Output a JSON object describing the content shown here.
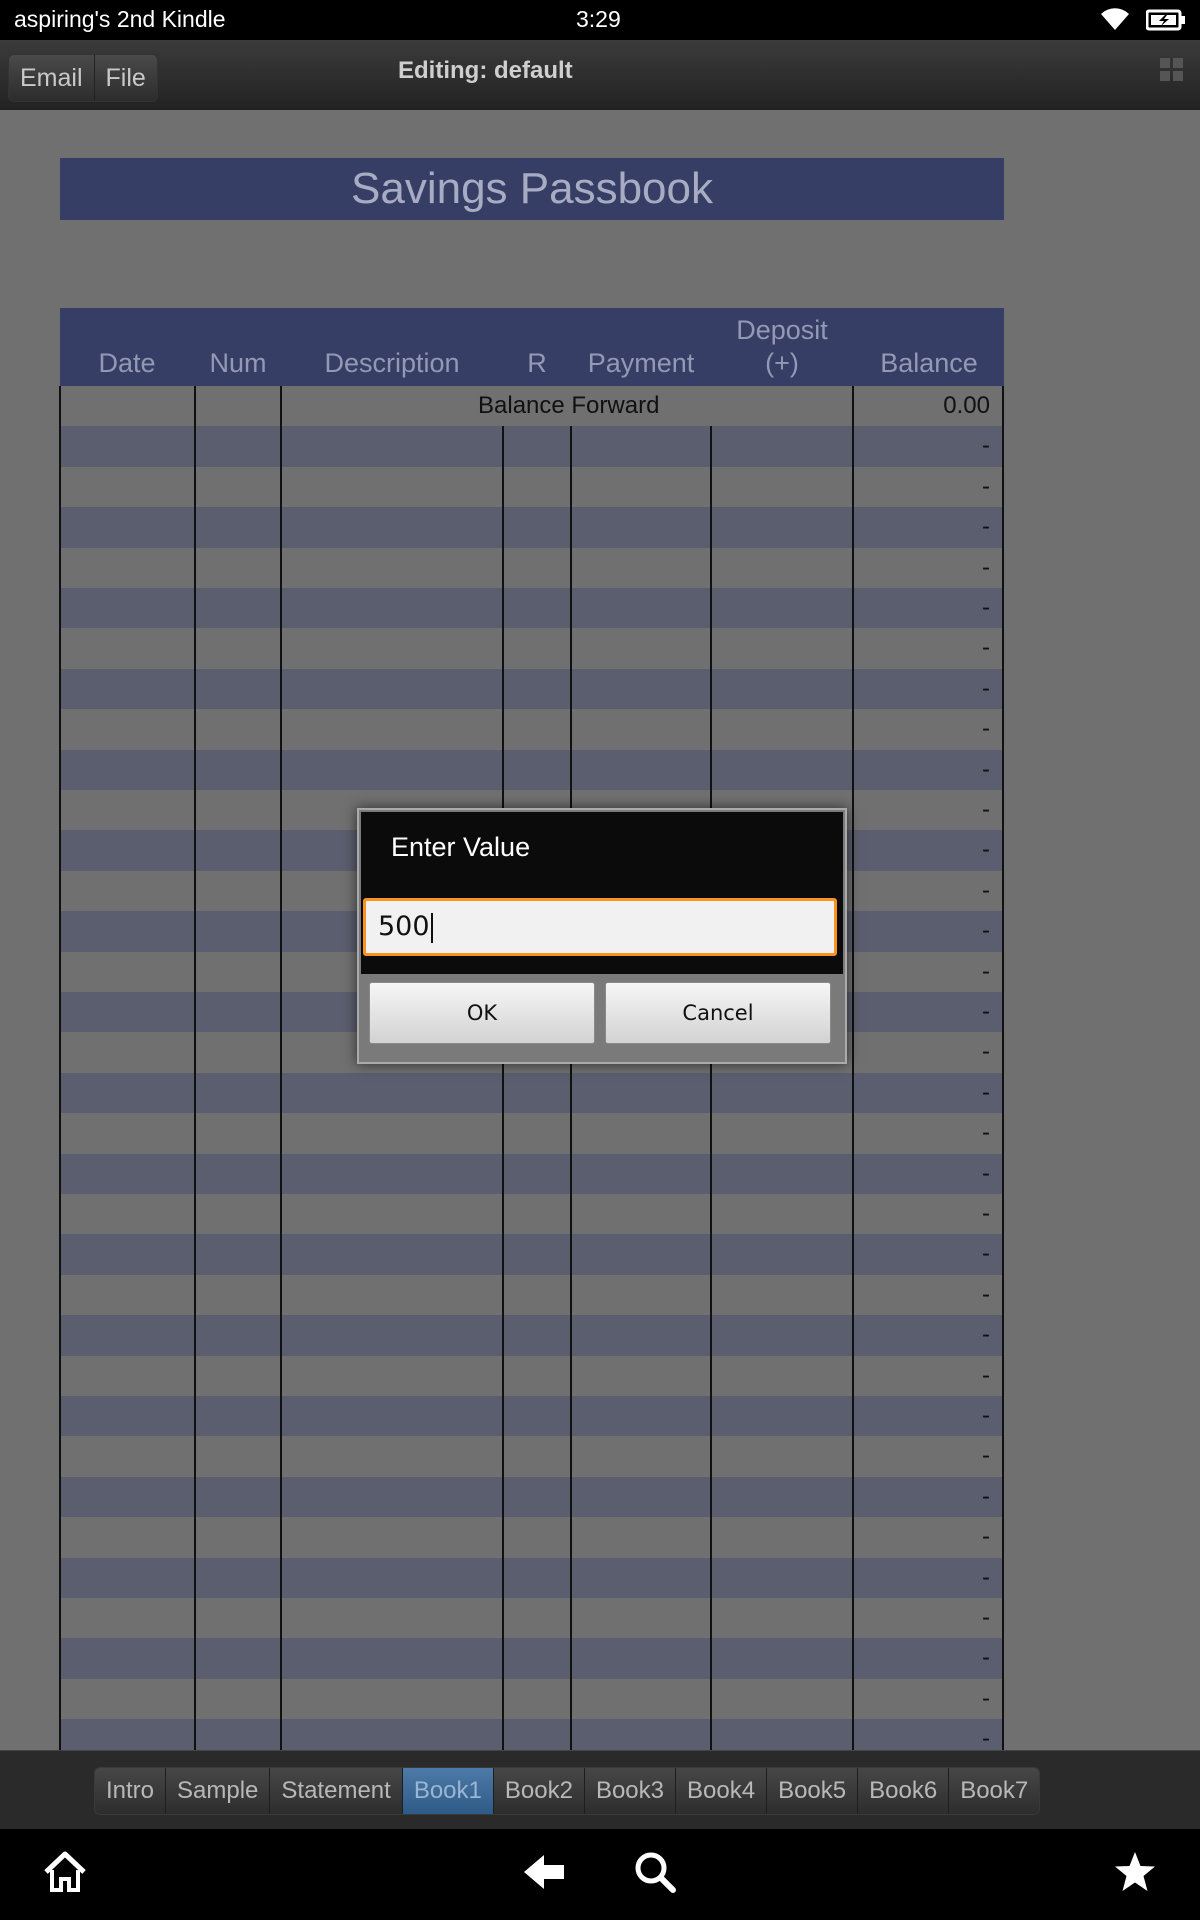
{
  "status_bar": {
    "device_name": "aspiring's 2nd Kindle",
    "time": "3:29",
    "wifi_icon": "wifi-icon",
    "battery_icon": "battery-charging-icon"
  },
  "action_bar": {
    "email_label": "Email",
    "file_label": "File",
    "editing_title": "Editing: default",
    "grid_icon": "grid-icon"
  },
  "sheet": {
    "title": "Savings Passbook",
    "columns": [
      "Date",
      "Num",
      "Description",
      "R",
      "Payment",
      "Deposit\n(+)",
      "Balance"
    ],
    "balance_forward_label": "Balance Forward",
    "balance_forward_value": "0.00",
    "empty_balance": "-",
    "colors": {
      "header_bg": "#373e66",
      "header_text": "#9399b4",
      "stripe": "#5b5e6e",
      "base": "#707070"
    }
  },
  "dialog": {
    "title": "Enter Value",
    "input_value": "500",
    "ok_label": "OK",
    "cancel_label": "Cancel",
    "accent": "#f7931e"
  },
  "sheet_tabs": {
    "items": [
      "Intro",
      "Sample",
      "Statement",
      "Book1",
      "Book2",
      "Book3",
      "Book4",
      "Book5",
      "Book6",
      "Book7"
    ],
    "active": "Book1"
  },
  "nav_bar": {
    "home_icon": "home-icon",
    "back_icon": "back-arrow-icon",
    "search_icon": "search-icon",
    "favorite_icon": "star-icon"
  }
}
